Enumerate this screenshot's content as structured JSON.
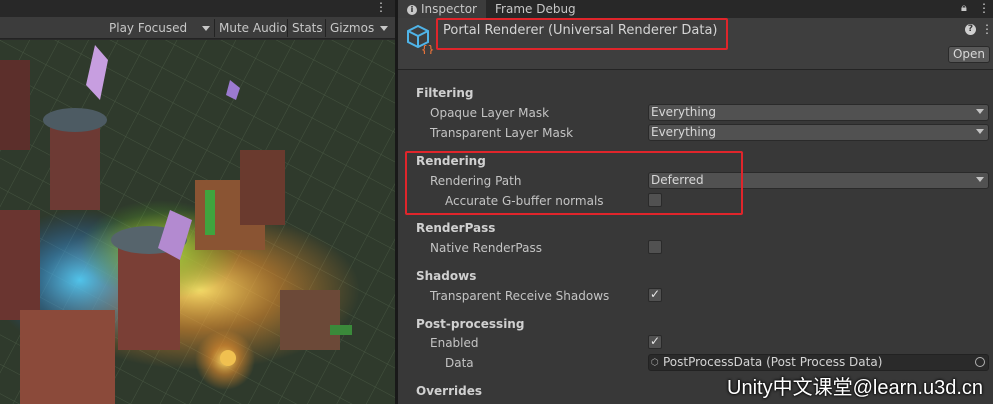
{
  "game_view": {
    "toolbar": {
      "play_focused": "Play Focused",
      "mute_audio": "Mute Audio",
      "stats": "Stats",
      "gizmos": "Gizmos"
    }
  },
  "inspector": {
    "tabs": [
      {
        "label": "Inspector",
        "icon": "info-icon",
        "active": true
      },
      {
        "label": "Frame Debug",
        "active": false
      }
    ],
    "asset_title": "Portal Renderer (Universal Renderer Data)",
    "open_button": "Open",
    "sections": {
      "filtering": {
        "title": "Filtering",
        "opaque_layer_mask": {
          "label": "Opaque Layer Mask",
          "value": "Everything"
        },
        "transparent_layer_mask": {
          "label": "Transparent Layer Mask",
          "value": "Everything"
        }
      },
      "rendering": {
        "title": "Rendering",
        "rendering_path": {
          "label": "Rendering Path",
          "value": "Deferred"
        },
        "accurate_gbuffer_normals": {
          "label": "Accurate G-buffer normals",
          "checked": false
        }
      },
      "renderpass": {
        "title": "RenderPass",
        "native_renderpass": {
          "label": "Native RenderPass",
          "checked": false
        }
      },
      "shadows": {
        "title": "Shadows",
        "transparent_receive_shadows": {
          "label": "Transparent Receive Shadows",
          "checked": true
        }
      },
      "post_processing": {
        "title": "Post-processing",
        "enabled": {
          "label": "Enabled",
          "checked": true
        },
        "data": {
          "label": "Data",
          "value": "PostProcessData (Post Process Data)"
        }
      },
      "overrides": {
        "title": "Overrides"
      }
    }
  },
  "watermark": "Unity中文课堂@learn.u3d.cn",
  "colors": {
    "panel_bg": "#383838",
    "header_bg": "#3e3e3e",
    "field_bg": "#515151",
    "highlight_red": "#e0252b"
  }
}
